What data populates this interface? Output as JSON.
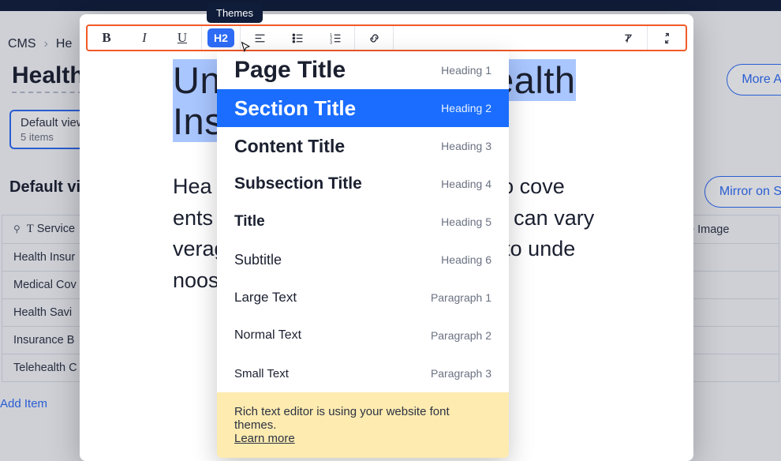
{
  "breadcrumb": {
    "root": "CMS",
    "current": "He"
  },
  "page": {
    "title": "Health"
  },
  "view_chip": {
    "label": "Default view",
    "sub": "5 items"
  },
  "buttons": {
    "more_actions": "More A",
    "mirror": "Mirror on S",
    "add_item": "Add Item"
  },
  "default_view_label": "Default vie",
  "table": {
    "headers": {
      "service": "Service",
      "image": "e Image"
    },
    "rows": [
      {
        "c0": "Health Insur"
      },
      {
        "c0": "Medical Cov"
      },
      {
        "c0": "Health Savi"
      },
      {
        "c0": "Insurance B"
      },
      {
        "c0": "Telehealth C"
      }
    ]
  },
  "tooltip": {
    "text": "Themes"
  },
  "toolbar": {
    "bold": "B",
    "italic": "I",
    "underline": "U",
    "heading_chip": "H2"
  },
  "editor": {
    "h2_prefix": "Un",
    "h2_gap": "ealth",
    "h2_line2": "Ins",
    "para": "Hea                                       gned to cove                                  ents and                                       ey can vary                                    verage, and                                     to unde                                      noosing a pla"
  },
  "dropdown": {
    "items": [
      {
        "label": "Page Title",
        "sub": "Heading 1"
      },
      {
        "label": "Section Title",
        "sub": "Heading 2"
      },
      {
        "label": "Content Title",
        "sub": "Heading 3"
      },
      {
        "label": "Subsection Title",
        "sub": "Heading 4"
      },
      {
        "label": "Title",
        "sub": "Heading 5"
      },
      {
        "label": "Subtitle",
        "sub": "Heading 6"
      },
      {
        "label": "Large Text",
        "sub": "Paragraph 1"
      },
      {
        "label": "Normal Text",
        "sub": "Paragraph 2"
      },
      {
        "label": "Small Text",
        "sub": "Paragraph 3"
      }
    ],
    "selected_index": 1,
    "note": "Rich text editor is using your website font themes.",
    "note_link": "Learn more"
  },
  "icons": {
    "pin": "📌",
    "text": "T"
  }
}
